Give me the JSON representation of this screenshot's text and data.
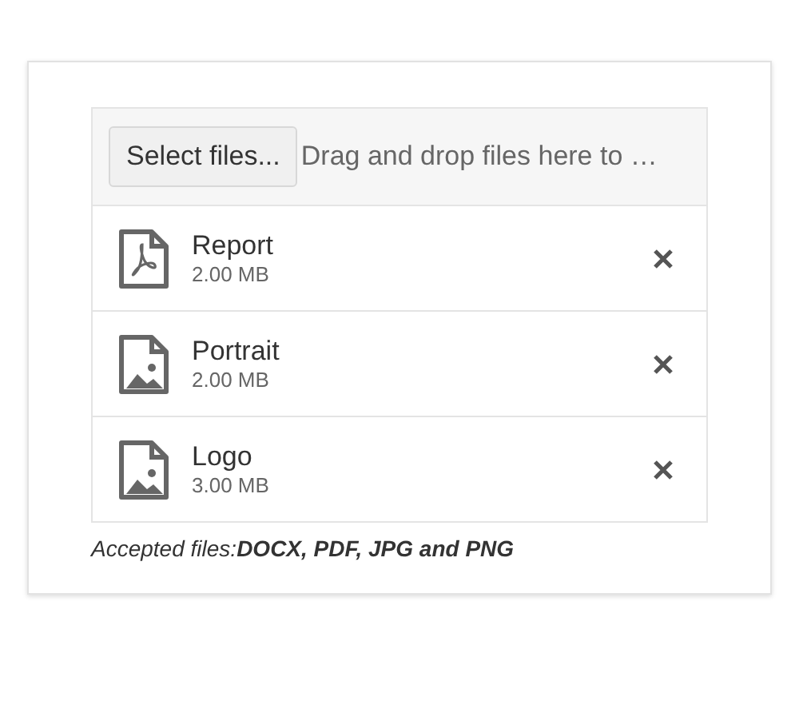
{
  "uploader": {
    "select_button": "Select files...",
    "drop_hint": "Drag and drop files here to …"
  },
  "files": [
    {
      "name": "Report",
      "size": "2.00 MB",
      "kind": "pdf"
    },
    {
      "name": "Portrait",
      "size": "2.00 MB",
      "kind": "image"
    },
    {
      "name": "Logo",
      "size": "3.00 MB",
      "kind": "image"
    }
  ],
  "note": "Accepted files:**DOCX, PDF, JPG and PNG**"
}
